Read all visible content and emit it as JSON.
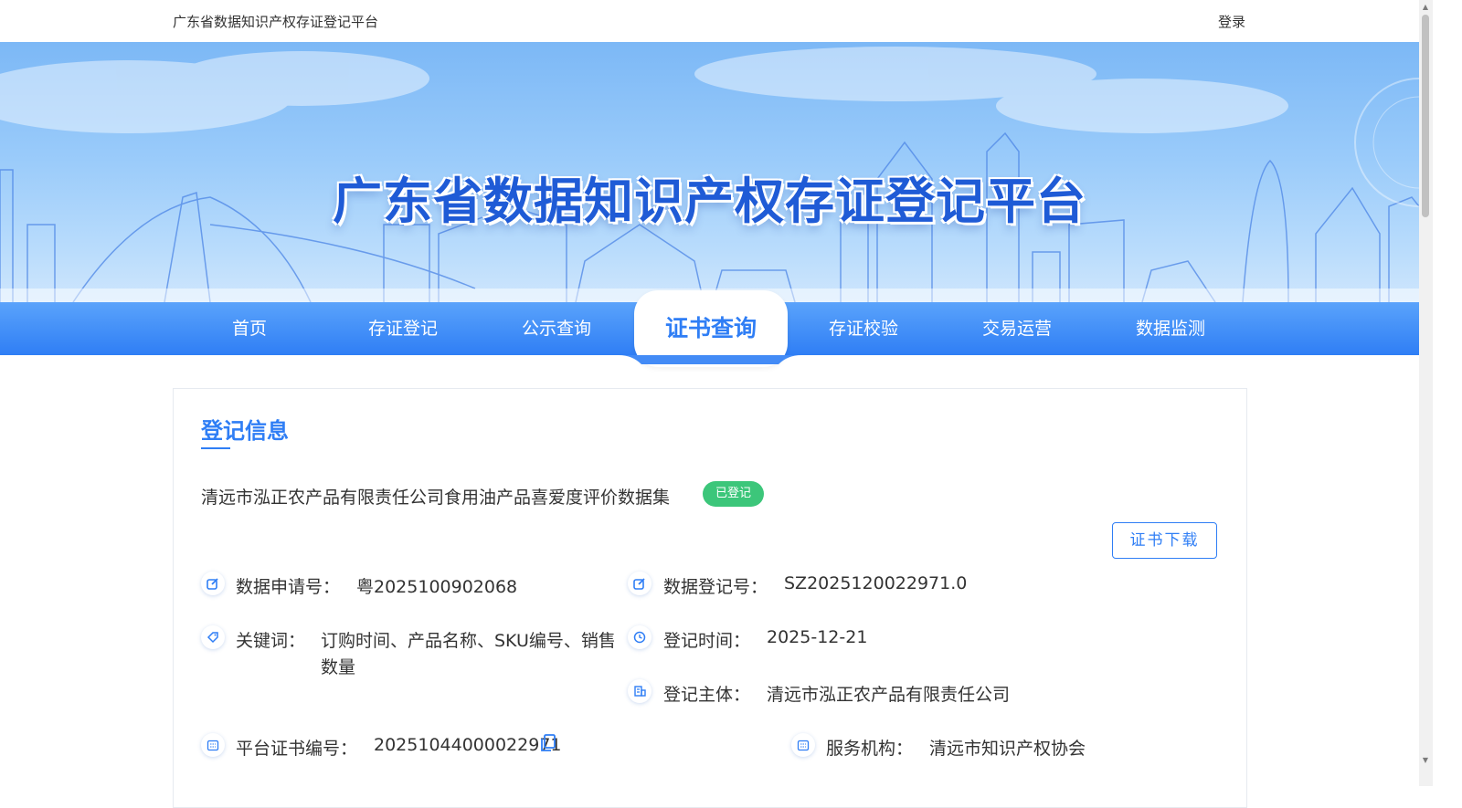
{
  "header": {
    "site_title": "广东省数据知识产权存证登记平台",
    "login_label": "登录"
  },
  "banner": {
    "title": "广东省数据知识产权存证登记平台"
  },
  "nav": {
    "items": [
      "首页",
      "存证登记",
      "公示查询",
      "证书查询",
      "存证校验",
      "交易运营",
      "数据监测"
    ],
    "active": "证书查询"
  },
  "record": {
    "section_title": "登记信息",
    "dataset_name": "清远市泓正农产品有限责任公司食用油产品喜爱度评价数据集",
    "status": "已登记",
    "download_label": "证书下载",
    "fields": {
      "apply_no": {
        "label": "数据申请号：",
        "value": "粤2025100902068"
      },
      "reg_no": {
        "label": "数据登记号：",
        "value": "SZ2025120022971.0"
      },
      "keywords": {
        "label": "关键词：",
        "value_line1": "订购时间、产品名称、SKU编号、销售",
        "value_line2": "数量"
      },
      "reg_time": {
        "label": "登记时间：",
        "value": "2025-12-21"
      },
      "reg_subject": {
        "label": "登记主体：",
        "value": "清远市泓正农产品有限责任公司"
      },
      "cert_no": {
        "label": "平台证书编号：",
        "value": "20251044000022971"
      },
      "service_org": {
        "label": "服务机构：",
        "value": "清远市知识产权协会"
      }
    }
  },
  "colors": {
    "accent": "#2f7ef5",
    "success": "#3cc67a",
    "banner_title": "#1f5bd6"
  }
}
